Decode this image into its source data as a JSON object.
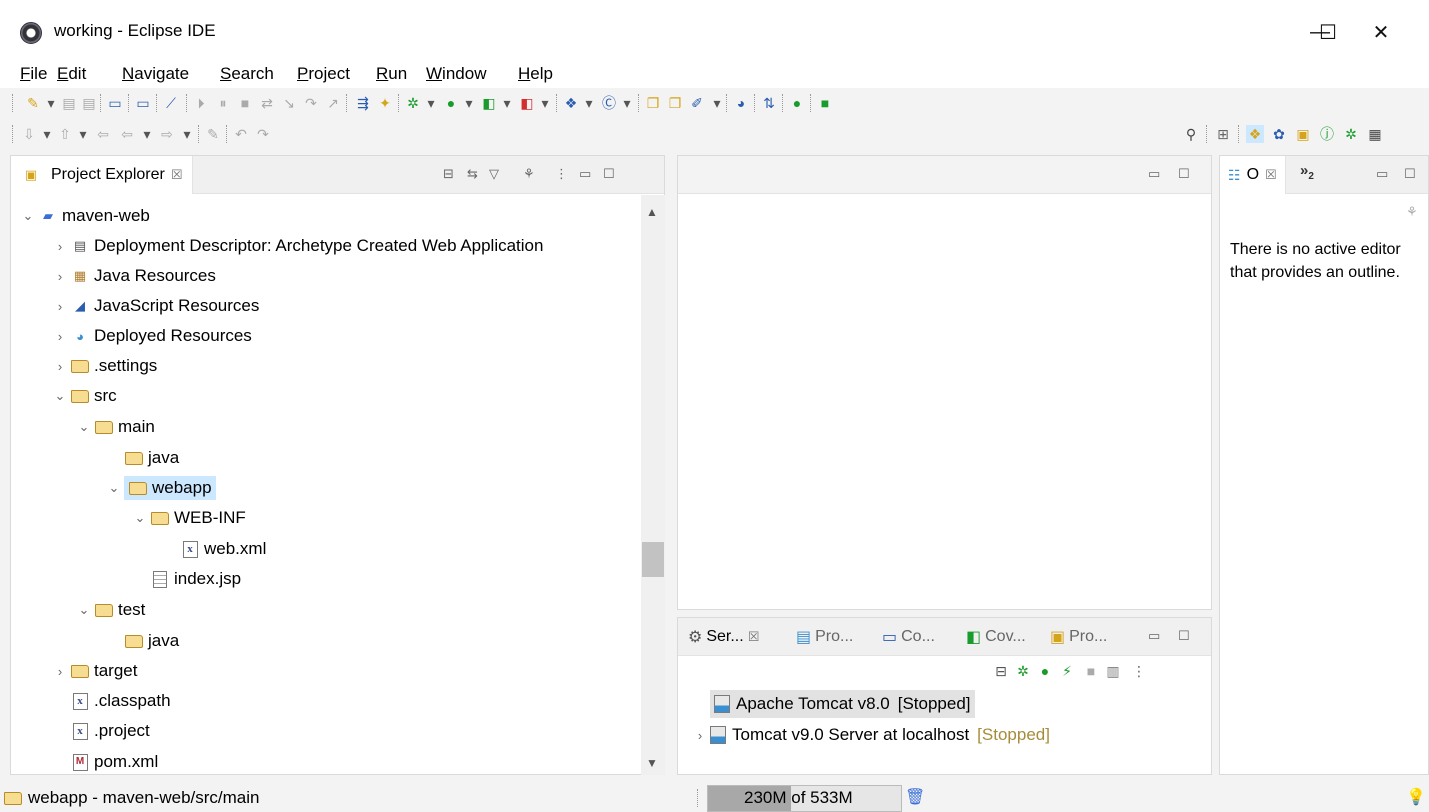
{
  "window": {
    "title": "working - Eclipse IDE",
    "minimize_glyph": "—",
    "maximize_glyph": "☐",
    "close_glyph": "✕"
  },
  "menu": [
    {
      "label": "File"
    },
    {
      "label": "Edit"
    },
    {
      "label": "Navigate"
    },
    {
      "label": "Search"
    },
    {
      "label": "Project"
    },
    {
      "label": "Run"
    },
    {
      "label": "Window"
    },
    {
      "label": "Help"
    }
  ],
  "project_explorer": {
    "tab_label": "Project Explorer",
    "tab_close": "☒",
    "tree": [
      {
        "label": "maven-web",
        "twisty": "⌄",
        "icon": "project-icon"
      },
      {
        "label": "Deployment Descriptor: Archetype Created Web Application",
        "twisty": "›",
        "icon": "descriptor-icon"
      },
      {
        "label": "Java Resources",
        "twisty": "›",
        "icon": "java-resources-icon"
      },
      {
        "label": "JavaScript Resources",
        "twisty": "›",
        "icon": "javascript-resources-icon"
      },
      {
        "label": "Deployed Resources",
        "twisty": "›",
        "icon": "deployed-resources-icon"
      },
      {
        "label": ".settings",
        "twisty": "›",
        "icon": "folder-icon"
      },
      {
        "label": "src",
        "twisty": "⌄",
        "icon": "folder-icon"
      },
      {
        "label": "main",
        "twisty": "⌄",
        "icon": "folder-icon"
      },
      {
        "label": "java",
        "twisty": "",
        "icon": "folder-icon"
      },
      {
        "label": "webapp",
        "twisty": "⌄",
        "icon": "folder-icon"
      },
      {
        "label": "WEB-INF",
        "twisty": "⌄",
        "icon": "folder-icon"
      },
      {
        "label": "web.xml",
        "twisty": "",
        "icon": "xml-file-icon"
      },
      {
        "label": "index.jsp",
        "twisty": "",
        "icon": "jsp-file-icon"
      },
      {
        "label": "test",
        "twisty": "⌄",
        "icon": "folder-icon"
      },
      {
        "label": "java",
        "twisty": "",
        "icon": "folder-icon"
      },
      {
        "label": "target",
        "twisty": "›",
        "icon": "folder-icon"
      },
      {
        "label": ".classpath",
        "twisty": "",
        "icon": "xml-file-icon"
      },
      {
        "label": ".project",
        "twisty": "",
        "icon": "xml-file-icon"
      },
      {
        "label": "pom.xml",
        "twisty": "",
        "icon": "maven-file-icon"
      }
    ],
    "selected_item": "webapp"
  },
  "outline": {
    "tab_label": "O",
    "overflow_label": "»",
    "overflow_count": "2",
    "message": "There is no active editor that provides an outline."
  },
  "servers": {
    "tabs": [
      {
        "label": "Ser...",
        "active": true
      },
      {
        "label": "Pro...",
        "active": false
      },
      {
        "label": "Co...",
        "active": false
      },
      {
        "label": "Cov...",
        "active": false
      },
      {
        "label": "Pro...",
        "active": false
      }
    ],
    "rows": [
      {
        "name": "Apache Tomcat v8.0",
        "status": "[Stopped]",
        "twisty": ""
      },
      {
        "name": "Tomcat v9.0 Server at localhost",
        "status": "[Stopped]",
        "twisty": "›"
      }
    ]
  },
  "status_bar": {
    "path": "webapp - maven-web/src/main",
    "heap_used": "230M",
    "heap_total": "533M",
    "heap_text": "230M of 533M",
    "heap_used_fraction": 0.43
  }
}
